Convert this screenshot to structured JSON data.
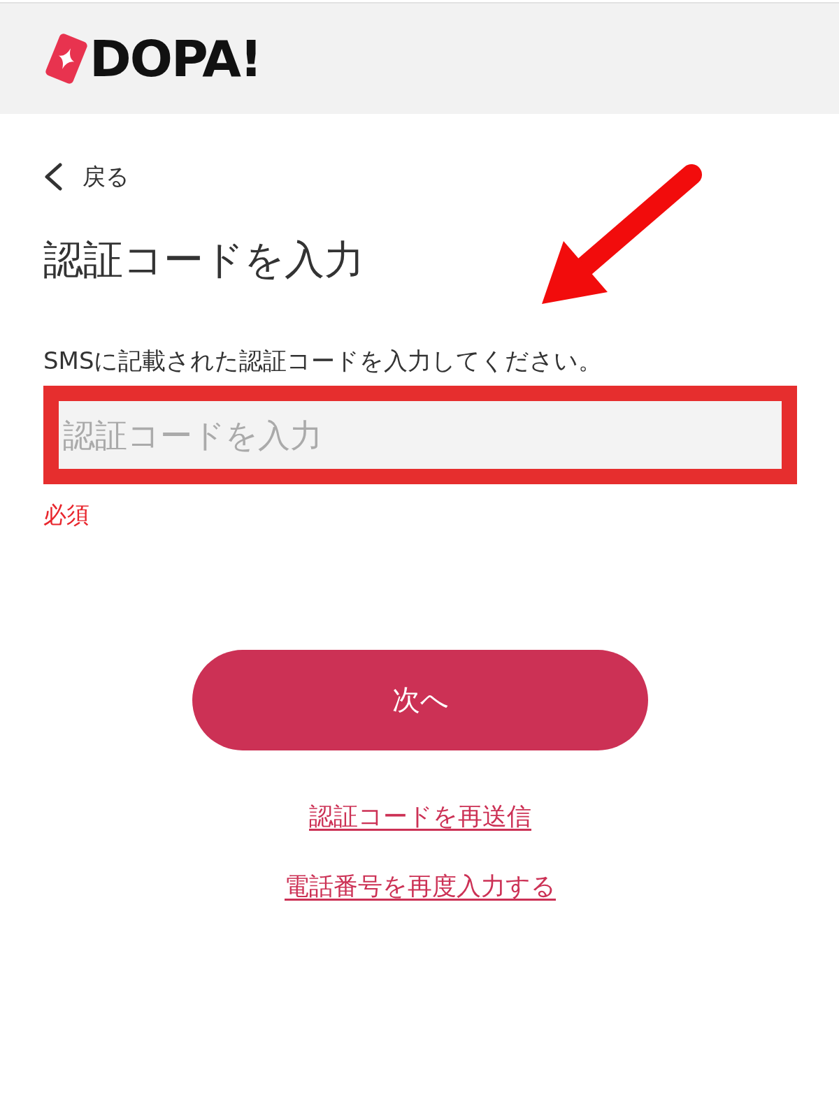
{
  "header": {
    "logo": {
      "text": "DOPA!"
    }
  },
  "back_link": {
    "label": "戻る"
  },
  "title": "認証コードを入力",
  "instruction": "SMSに記載された認証コードを入力してください。",
  "code_field": {
    "placeholder": "認証コードを入力",
    "highlighted": true,
    "error": "必須"
  },
  "next_button": {
    "label": "次へ"
  },
  "links": [
    {
      "label": "認証コードを再送信"
    },
    {
      "label": "電話番号を再度入力する"
    }
  ],
  "annotations": [
    {
      "kind": "arrow"
    }
  ]
}
